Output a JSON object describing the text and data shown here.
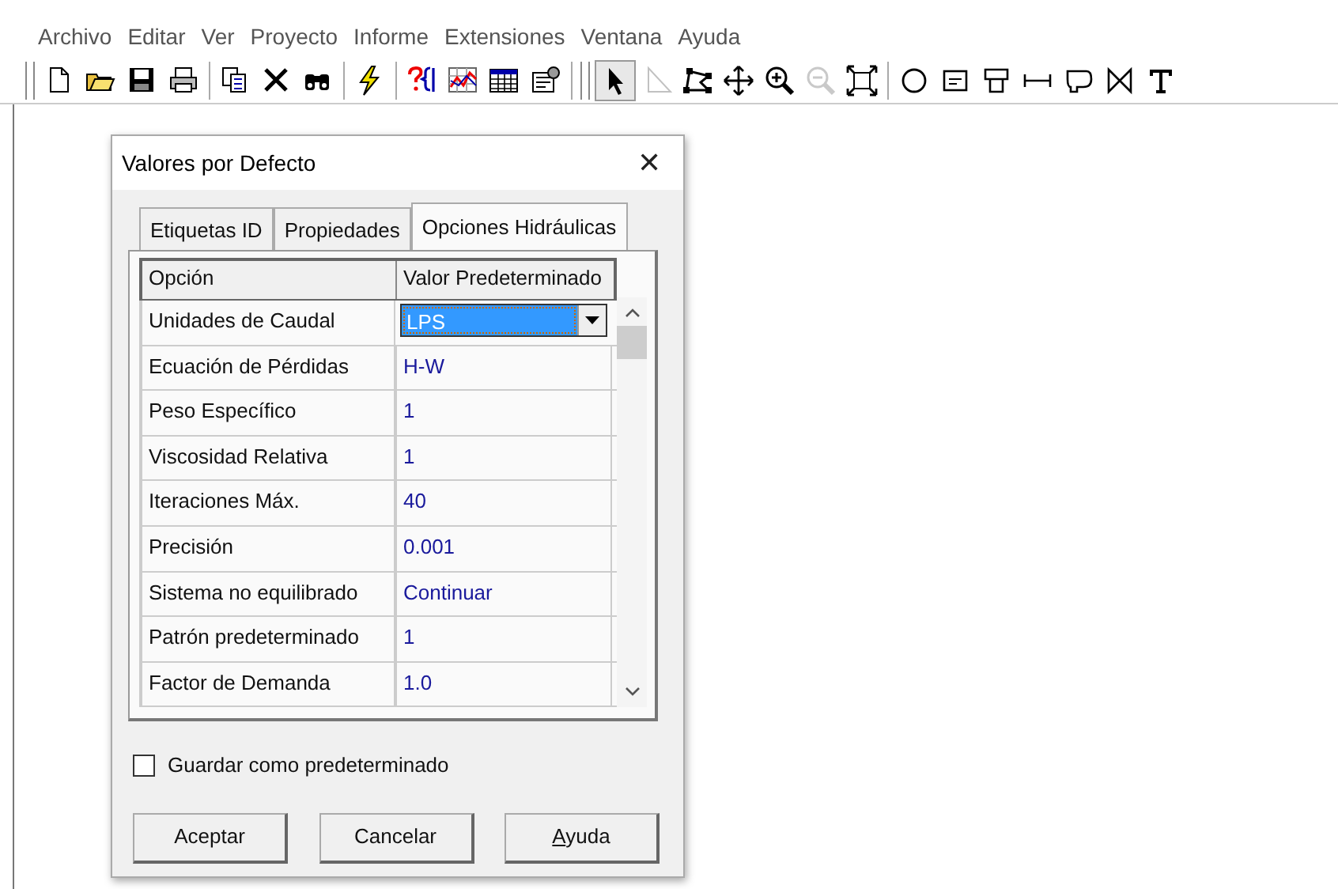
{
  "menu": [
    "Archivo",
    "Editar",
    "Ver",
    "Proyecto",
    "Informe",
    "Extensiones",
    "Ventana",
    "Ayuda"
  ],
  "toolbar": [
    [
      {
        "kind": "new"
      },
      {
        "kind": "open"
      },
      {
        "kind": "save"
      },
      {
        "kind": "print"
      }
    ],
    [
      {
        "kind": "copy"
      },
      {
        "kind": "delete"
      },
      {
        "kind": "find"
      }
    ],
    [
      {
        "kind": "run"
      }
    ],
    [
      {
        "kind": "query"
      },
      {
        "kind": "graph"
      },
      {
        "kind": "table"
      },
      {
        "kind": "options"
      }
    ],
    [
      {
        "kind": "select",
        "selected": true,
        "disabled": false
      },
      {
        "kind": "vertex",
        "selected": false,
        "disabled": true
      },
      {
        "kind": "region",
        "selected": false,
        "disabled": false
      },
      {
        "kind": "pan",
        "selected": false,
        "disabled": false
      },
      {
        "kind": "zoomin",
        "selected": false,
        "disabled": false
      },
      {
        "kind": "zoomout",
        "selected": false,
        "disabled": true
      },
      {
        "kind": "extent",
        "selected": false,
        "disabled": false
      }
    ],
    [
      {
        "kind": "junction"
      },
      {
        "kind": "reservoir"
      },
      {
        "kind": "tank"
      },
      {
        "kind": "pipe"
      },
      {
        "kind": "pump"
      },
      {
        "kind": "valve"
      },
      {
        "kind": "label"
      }
    ]
  ],
  "dialog": {
    "title": "Valores por Defecto",
    "close": "✕",
    "tabs": [
      {
        "label": "Etiquetas ID",
        "selected": false
      },
      {
        "label": "Propiedades",
        "selected": false
      },
      {
        "label": "Opciones Hidráulicas",
        "selected": true
      }
    ],
    "table": {
      "columns": [
        "Opción",
        "Valor Predeterminado"
      ],
      "rows": [
        {
          "option": "Unidades de Caudal",
          "value": "LPS",
          "kind": "dropdown"
        },
        {
          "option": "Ecuación de Pérdidas",
          "value": "H-W",
          "kind": "text"
        },
        {
          "option": "Peso Específico",
          "value": "1",
          "kind": "text"
        },
        {
          "option": "Viscosidad Relativa",
          "value": "1",
          "kind": "text"
        },
        {
          "option": "Iteraciones Máx.",
          "value": "40",
          "kind": "text"
        },
        {
          "option": "Precisión",
          "value": "0.001",
          "kind": "text"
        },
        {
          "option": "Sistema no equilibrado",
          "value": "Continuar",
          "kind": "text"
        },
        {
          "option": "Patrón predeterminado",
          "value": "1",
          "kind": "text"
        },
        {
          "option": "Factor de Demanda",
          "value": "1.0",
          "kind": "text"
        }
      ]
    },
    "checkbox": {
      "label": "Guardar como predeterminado",
      "checked": false
    },
    "buttons": [
      {
        "label": "Aceptar",
        "mnemonic": false
      },
      {
        "label": "Cancelar",
        "mnemonic": false
      },
      {
        "label": "Ayuda",
        "mnemonic": true
      }
    ]
  }
}
